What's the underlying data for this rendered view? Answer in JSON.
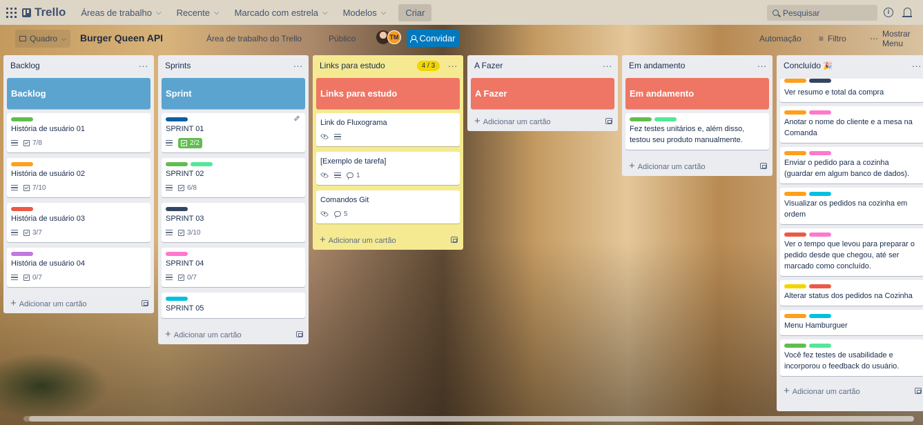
{
  "topbar": {
    "logo": "Trello",
    "nav": [
      "Áreas de trabalho",
      "Recente",
      "Marcado com estrela",
      "Modelos"
    ],
    "create": "Criar",
    "search_placeholder": "Pesquisar"
  },
  "board": {
    "view": "Quadro",
    "title": "Burger Queen API",
    "workspace": "Área de trabalho do Trello",
    "visibility": "Público",
    "member_initials": "TM",
    "invite": "Convidar",
    "automation": "Automação",
    "filter": "Filtro",
    "show_menu": "Mostrar Menu"
  },
  "lists": [
    {
      "title": "Backlog",
      "cover": "Backlog",
      "cards": [
        {
          "title": "História de usuário 01",
          "labels": [
            "#61bd4f"
          ],
          "checklist": "7/8"
        },
        {
          "title": "História de usuário 02",
          "labels": [
            "#ff9f1a"
          ],
          "checklist": "7/10"
        },
        {
          "title": "História de usuário 03",
          "labels": [
            "#eb5a46"
          ],
          "checklist": "3/7"
        },
        {
          "title": "História de usuário 04",
          "labels": [
            "#c377e0"
          ],
          "checklist": "0/7"
        }
      ],
      "add": "Adicionar um cartão"
    },
    {
      "title": "Sprints",
      "cover": "Sprint",
      "cards": [
        {
          "title": "SPRINT 01",
          "labels": [
            "#0b5ea1"
          ],
          "checklist": "2/2"
        },
        {
          "title": "SPRINT 02",
          "labels": [
            "#61bd4f",
            "#51e898"
          ],
          "checklist": "6/8"
        },
        {
          "title": "SPRINT 03",
          "labels": [
            "#344563"
          ],
          "checklist": "3/10"
        },
        {
          "title": "SPRINT 04",
          "labels": [
            "#ff78cb"
          ],
          "checklist": "0/7"
        },
        {
          "title": "SPRINT 05",
          "labels": [
            "#00c2e0"
          ]
        }
      ],
      "add": "Adicionar um cartão"
    },
    {
      "title": "Links para estudo",
      "count": "4 / 3",
      "cover": "Links para estudo",
      "cards": [
        {
          "title": "Link do Fluxograma"
        },
        {
          "title": "[Exemplo de tarefa]",
          "comments": "1"
        },
        {
          "title": "Comandos Git",
          "comments": "5"
        }
      ],
      "add": "Adicionar um cartão"
    },
    {
      "title": "A Fazer",
      "cover": "A Fazer",
      "add": "Adicionar um cartão"
    },
    {
      "title": "Em andamento",
      "cover": "Em andamento",
      "cards": [
        {
          "title": "Fez testes unitários e, além disso, testou seu produto manualmente.",
          "labels": [
            "#61bd4f",
            "#51e898"
          ]
        }
      ],
      "add": "Adicionar um cartão"
    },
    {
      "title": "Concluído",
      "cards": [
        {
          "title": "Ver resumo e total da compra",
          "labels": [
            "#ff9f1a",
            "#344563"
          ]
        },
        {
          "title": "Anotar o nome do cliente e a mesa na Comanda",
          "labels": [
            "#ff9f1a",
            "#ff78cb"
          ]
        },
        {
          "title": "Enviar o pedido para a cozinha (guardar em algum banco de dados).",
          "labels": [
            "#ff9f1a",
            "#ff78cb"
          ]
        },
        {
          "title": "Visualizar os pedidos na cozinha em ordem",
          "labels": [
            "#ff9f1a",
            "#00c2e0"
          ]
        },
        {
          "title": "Ver o tempo que levou para preparar o pedido desde que chegou, até ser marcado como concluído.",
          "labels": [
            "#eb5a46",
            "#ff78cb"
          ]
        },
        {
          "title": "Alterar status dos pedidos na Cozinha",
          "labels": [
            "#f2d600",
            "#eb5a46"
          ]
        },
        {
          "title": "Menu Hamburguer",
          "labels": [
            "#ff9f1a",
            "#00c2e0"
          ]
        },
        {
          "title": "Você fez testes de usabilidade e incorporou o feedback do usuário.",
          "labels": [
            "#61bd4f",
            "#51e898"
          ]
        }
      ],
      "add": "Adicionar um cartão"
    }
  ],
  "colors": {
    "cover_blue": "#5ba4cf",
    "cover_red": "#ef7564",
    "invite": "#0079bf",
    "yellow_list": "#f5ea92"
  }
}
